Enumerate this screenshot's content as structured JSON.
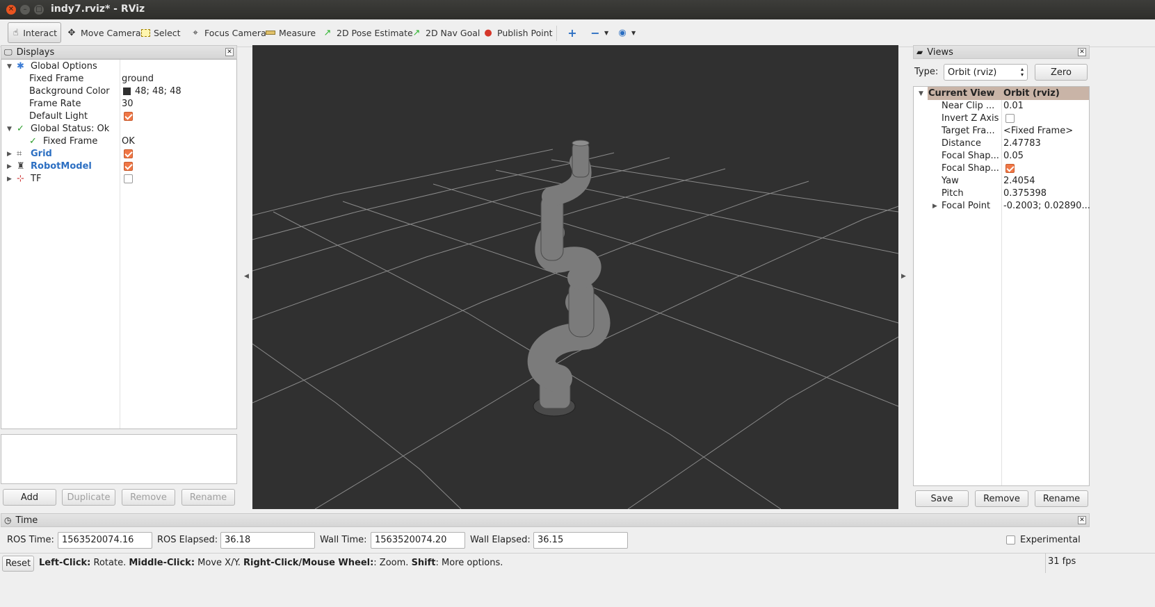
{
  "window": {
    "title": "indy7.rviz* - RViz"
  },
  "toolbar": {
    "tools": [
      {
        "label": "Interact",
        "icon": "hand-icon"
      },
      {
        "label": "Move Camera",
        "icon": "move-arrows-icon"
      },
      {
        "label": "Select",
        "icon": "select-box-icon"
      },
      {
        "label": "Focus Camera",
        "icon": "focus-target-icon"
      },
      {
        "label": "Measure",
        "icon": "ruler-icon"
      },
      {
        "label": "2D Pose Estimate",
        "icon": "green-arrow-icon"
      },
      {
        "label": "2D Nav Goal",
        "icon": "green-arrow-icon"
      },
      {
        "label": "Publish Point",
        "icon": "map-pin-icon"
      }
    ],
    "add_icon": "plus-icon",
    "remove_icon": "minus-icon",
    "view_icon": "eye-icon"
  },
  "displays": {
    "title": "Displays",
    "rows": [
      {
        "name": "Global Options",
        "value": ""
      },
      {
        "name": "Fixed Frame",
        "value": "ground"
      },
      {
        "name": "Background Color",
        "value": "48; 48; 48"
      },
      {
        "name": "Frame Rate",
        "value": "30"
      },
      {
        "name": "Default Light",
        "value": ""
      },
      {
        "name": "Global Status: Ok",
        "value": ""
      },
      {
        "name": "Fixed Frame",
        "value": "OK"
      },
      {
        "name": "Grid",
        "value": ""
      },
      {
        "name": "RobotModel",
        "value": ""
      },
      {
        "name": "TF",
        "value": ""
      }
    ],
    "buttons": {
      "add": "Add",
      "duplicate": "Duplicate",
      "remove": "Remove",
      "rename": "Rename"
    }
  },
  "views": {
    "title": "Views",
    "type_label": "Type:",
    "type_value": "Orbit (rviz)",
    "zero_button": "Zero",
    "header": {
      "name": "Current View",
      "value": "Orbit (rviz)"
    },
    "rows": [
      {
        "name": "Near Clip ...",
        "value": "0.01"
      },
      {
        "name": "Invert Z Axis",
        "value": ""
      },
      {
        "name": "Target Fra...",
        "value": "<Fixed Frame>"
      },
      {
        "name": "Distance",
        "value": "2.47783"
      },
      {
        "name": "Focal Shap...",
        "value": "0.05"
      },
      {
        "name": "Focal Shap...",
        "value": ""
      },
      {
        "name": "Yaw",
        "value": "2.4054"
      },
      {
        "name": "Pitch",
        "value": "0.375398"
      },
      {
        "name": "Focal Point",
        "value": "-0.2003; 0.02890..."
      }
    ],
    "buttons": {
      "save": "Save",
      "remove": "Remove",
      "rename": "Rename"
    }
  },
  "time": {
    "title": "Time",
    "ros_time_label": "ROS Time:",
    "ros_time": "1563520074.16",
    "ros_elapsed_label": "ROS Elapsed:",
    "ros_elapsed": "36.18",
    "wall_time_label": "Wall Time:",
    "wall_time": "1563520074.20",
    "wall_elapsed_label": "Wall Elapsed:",
    "wall_elapsed": "36.15",
    "experimental_label": "Experimental"
  },
  "status": {
    "reset": "Reset",
    "help_k1": "Left-Click:",
    "help_t1": " Rotate. ",
    "help_k2": "Middle-Click:",
    "help_t2": " Move X/Y. ",
    "help_k3": "Right-Click/Mouse Wheel:",
    "help_t3": ": Zoom. ",
    "help_k4": "Shift",
    "help_t4": ": More options.",
    "fps": "31 fps"
  },
  "colors": {
    "viewport_bg": "#303030",
    "accent_check": "#f07746",
    "link_blue": "#2c6fc2"
  }
}
